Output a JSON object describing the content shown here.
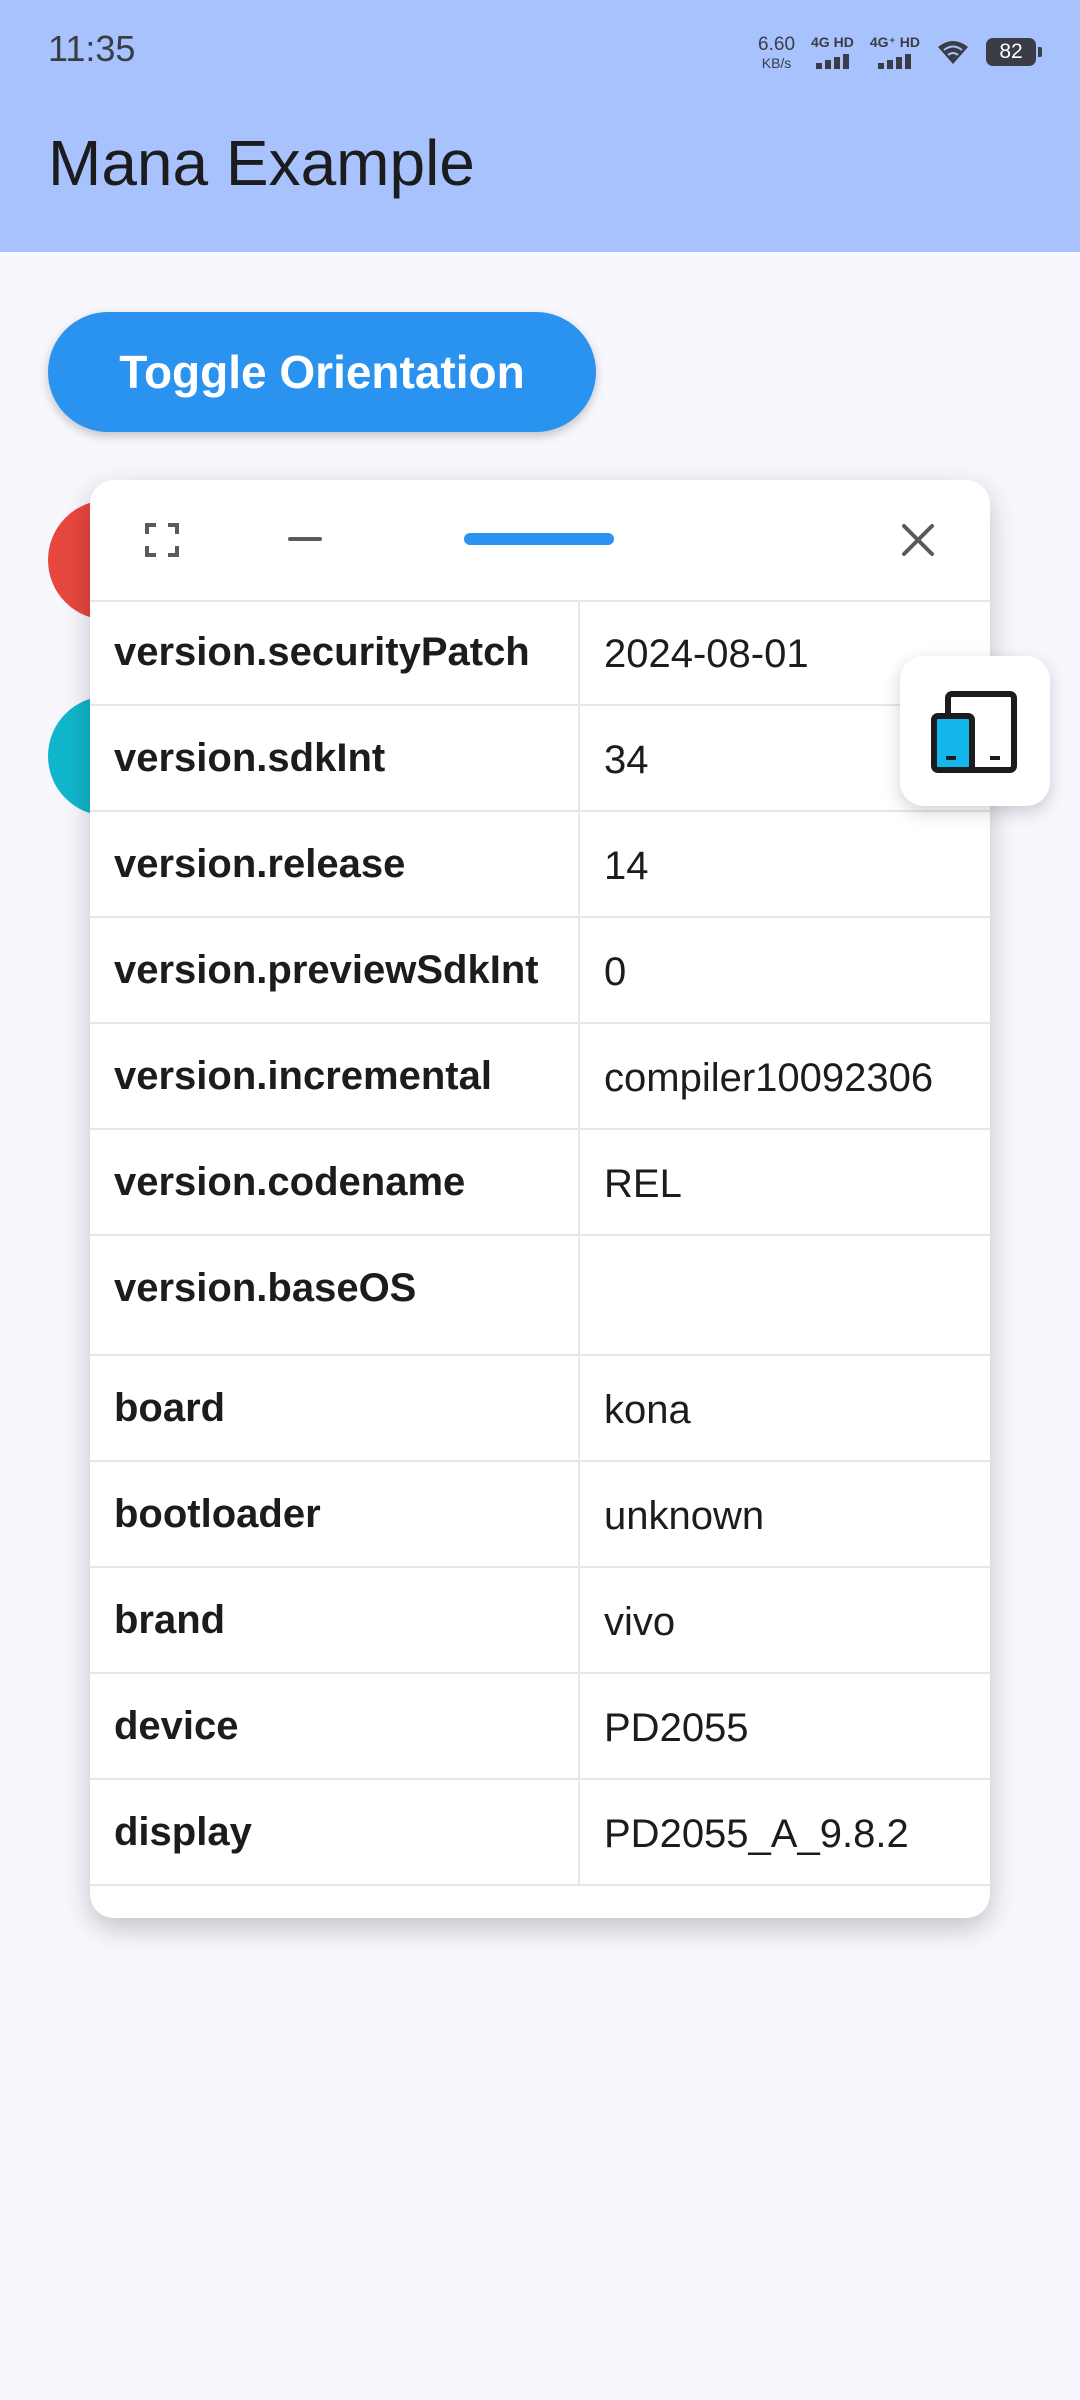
{
  "status_bar": {
    "time": "11:35",
    "net_speed_value": "6.60",
    "net_speed_unit": "KB/s",
    "sim1_label": "4G HD",
    "sim2_label": "4G⁺ HD",
    "battery_level": "82",
    "icons": [
      "signal-icon",
      "wifi-icon",
      "battery-icon"
    ]
  },
  "app_bar": {
    "title": "Mana Example",
    "color": "#a8c2fd"
  },
  "main": {
    "toggle_button_label": "Toggle Orientation",
    "accent_color": "#2a93ef",
    "fab_colors": [
      "#e8473f",
      "#12b6cc"
    ]
  },
  "device_info_panel": {
    "header_icons": [
      "expand-icon",
      "minimize-icon",
      "drag-handle",
      "close-icon"
    ],
    "rows": [
      {
        "key": "version.securityPatch",
        "value": "2024-08-01"
      },
      {
        "key": "version.sdkInt",
        "value": "34"
      },
      {
        "key": "version.release",
        "value": "14"
      },
      {
        "key": "version.previewSdkInt",
        "value": "0"
      },
      {
        "key": "version.incremental",
        "value": "compiler10092306"
      },
      {
        "key": "version.codename",
        "value": "REL"
      },
      {
        "key": "version.baseOS",
        "value": ""
      },
      {
        "key": "board",
        "value": "kona"
      },
      {
        "key": "bootloader",
        "value": "unknown"
      },
      {
        "key": "brand",
        "value": "vivo"
      },
      {
        "key": "device",
        "value": "PD2055"
      },
      {
        "key": "display",
        "value": "PD2055_A_9.8.2"
      }
    ]
  },
  "floating_button": {
    "icon": "device-orientation-icon"
  }
}
